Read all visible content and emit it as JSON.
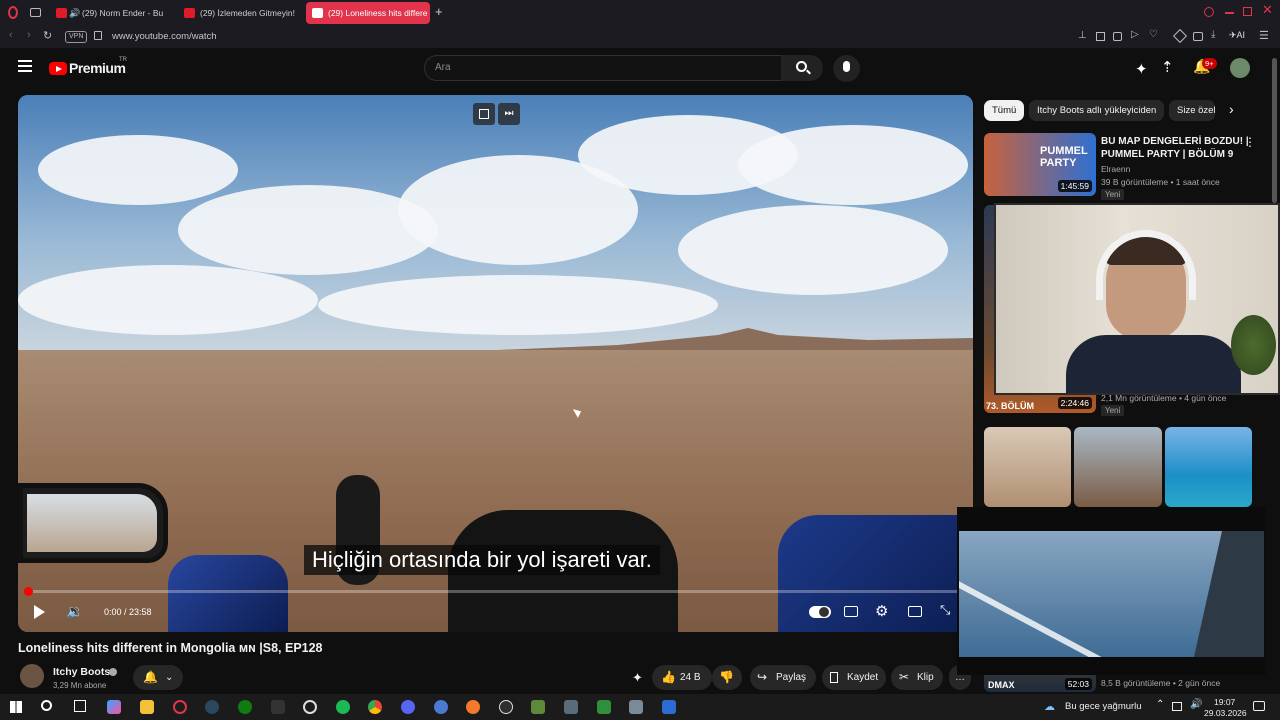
{
  "browser": {
    "tabs": [
      {
        "title": "(29) Norm Ender - Bu",
        "active": false
      },
      {
        "title": "(29) İzlemeden Gitmeyin!",
        "active": false
      },
      {
        "title": "(29) Loneliness hits differe",
        "active": true
      }
    ],
    "new_tab_label": "+",
    "vpn_label": "VPN",
    "url": "www.youtube.com/watch",
    "ai_label": "AI"
  },
  "youtube": {
    "logo_text": "Premium",
    "logo_region": "TR",
    "search_placeholder": "Ara",
    "notification_count": "9+"
  },
  "player": {
    "subtitle": "Hiçliğin ortasında bir yol işareti var.",
    "time": "0:00 / 23:58",
    "progress_fraction": 0.0
  },
  "video": {
    "title": "Loneliness hits different in Mongolia 🇲🇳 |S8, EP128",
    "title_text": "Loneliness hits different in Mongolia ᴍɴ |S8, EP128",
    "channel": "Itchy Boots",
    "subscribers": "3,29 Mn abone",
    "likes": "24 B",
    "share_label": "Paylaş",
    "save_label": "Kaydet",
    "clip_label": "Klip"
  },
  "sidebar": {
    "chips": [
      "Tümü",
      "Itchy Boots adlı yükleyiciden",
      "Size özel"
    ],
    "videos": [
      {
        "title_line1": "BU MAP DENGELERİ BOZDU! |",
        "title_line2": "PUMMEL PARTY | BÖLÜM 9",
        "channel": "Elraenn",
        "meta": "39 B görüntüleme • 1 saat önce",
        "badge": "Yeni",
        "duration": "1:45:59",
        "thumb_text": "PUMMEL PARTY"
      },
      {
        "meta": "2,1 Mn görüntüleme • 4 gün önce",
        "badge": "Yeni",
        "duration": "2:24:46",
        "thumb_text": "73. BÖLÜM"
      },
      {
        "meta": "8,5 B görüntüleme • 2 gün önce",
        "duration": "52:03",
        "thumb_text": "DMAX"
      }
    ]
  },
  "taskbar": {
    "weather": "Bu gece yağmurlu",
    "time": "19:07",
    "date": "29.03.2026"
  }
}
